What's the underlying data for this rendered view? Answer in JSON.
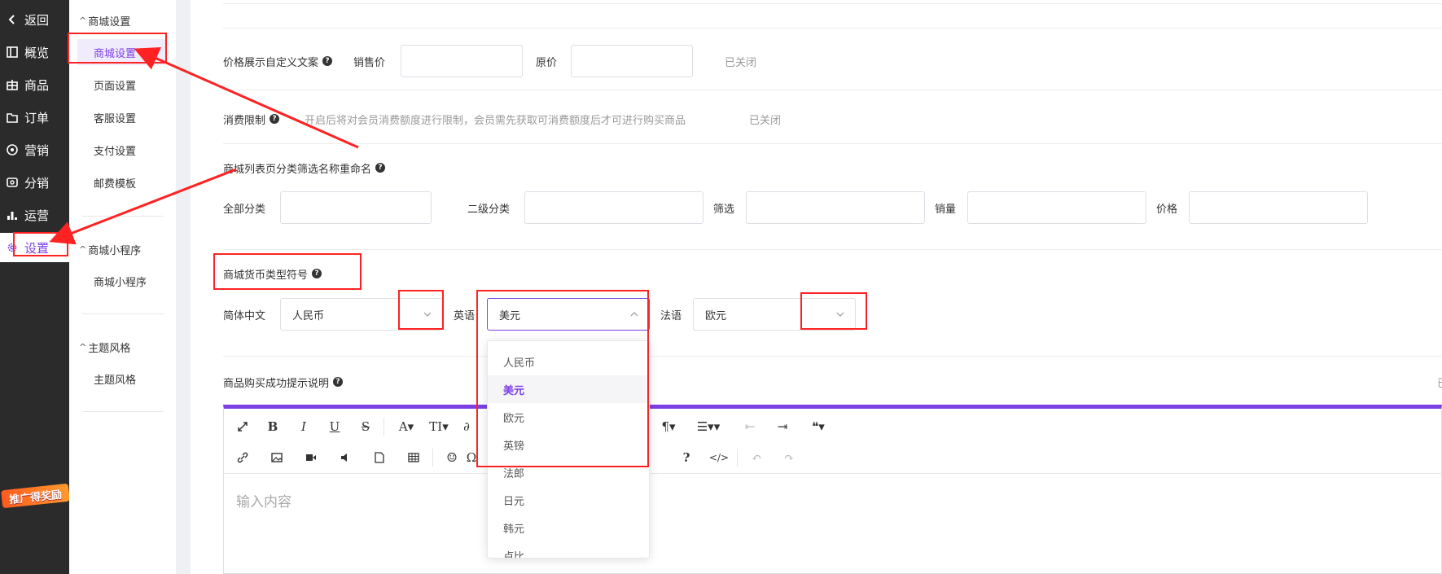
{
  "primary_nav": [
    {
      "icon": "chevron-left-icon",
      "label": "返回"
    },
    {
      "icon": "overview-icon",
      "label": "概览"
    },
    {
      "icon": "goods-icon",
      "label": "商品"
    },
    {
      "icon": "order-icon",
      "label": "订单"
    },
    {
      "icon": "marketing-icon",
      "label": "营销"
    },
    {
      "icon": "distribution-icon",
      "label": "分销"
    },
    {
      "icon": "chart-icon",
      "label": "运营"
    },
    {
      "icon": "gear-icon",
      "label": "设置",
      "active": true
    }
  ],
  "promo": {
    "label": "推广得奖励"
  },
  "secondary_nav": {
    "groups": [
      {
        "title": "商城设置",
        "items": [
          "商城设置",
          "页面设置",
          "客服设置",
          "支付设置",
          "邮费模板"
        ],
        "active": "商城设置"
      },
      {
        "title": "商城小程序",
        "items": [
          "商城小程序"
        ]
      },
      {
        "title": "主题风格",
        "items": [
          "主题风格"
        ]
      }
    ]
  },
  "price_display": {
    "label": "价格展示自定义文案",
    "sale_label": "销售价",
    "sale_value": "",
    "original_label": "原价",
    "original_value": "",
    "status": "已关闭"
  },
  "spend_limit": {
    "label": "消费限制",
    "hint": "开启后将对会员消费额度进行限制，会员需先获取可消费额度后才可进行购买商品",
    "status": "已关闭"
  },
  "category_rename": {
    "label": "商城列表页分类筛选名称重命名",
    "fields": [
      {
        "label": "全部分类",
        "value": ""
      },
      {
        "label": "二级分类",
        "value": ""
      },
      {
        "label": "筛选",
        "value": ""
      },
      {
        "label": "销量",
        "value": ""
      },
      {
        "label": "价格",
        "value": ""
      }
    ]
  },
  "currency": {
    "label": "商城货币类型符号",
    "selects": [
      {
        "label": "简体中文",
        "value": "人民币"
      },
      {
        "label": "英语",
        "value": "美元",
        "open": true
      },
      {
        "label": "法语",
        "value": "欧元"
      }
    ],
    "options": [
      "人民币",
      "美元",
      "欧元",
      "英镑",
      "法郎",
      "日元",
      "韩元",
      "卢比"
    ],
    "selected_option": "美元"
  },
  "purchase_tip": {
    "label": "商品购买成功提示说明",
    "editor_placeholder": "输入内容",
    "trailing_status_fragment": "已"
  },
  "colors": {
    "accent": "#7b3fe4",
    "annotation": "#ff2222",
    "sidebar_dark": "#2b2b2b"
  }
}
